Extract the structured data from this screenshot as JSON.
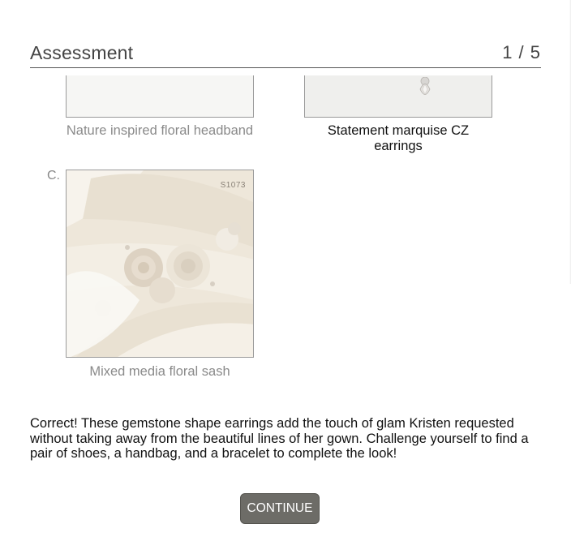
{
  "assessment": {
    "title": "Assessment",
    "progress": "1 / 5"
  },
  "options": [
    {
      "caption": "Nature inspired floral headband",
      "state": "dimmed"
    },
    {
      "caption": "Statement marquise CZ earrings",
      "state": "selected"
    },
    {
      "letter": "C.",
      "caption": "Mixed media floral sash",
      "sku": "S1073",
      "state": "dimmed"
    }
  ],
  "feedback": "Correct! These gemstone shape earrings add the touch of glam Kristen requested without taking away from the beautiful lines of her gown. Challenge yourself to find a pair of shoes, a handbag, and a bracelet to complete the look!",
  "continue_label": "CONTINUE",
  "colors": {
    "button": "#6d6c67",
    "divider": "#555555",
    "dimmed_text": "#8a8a8a"
  }
}
